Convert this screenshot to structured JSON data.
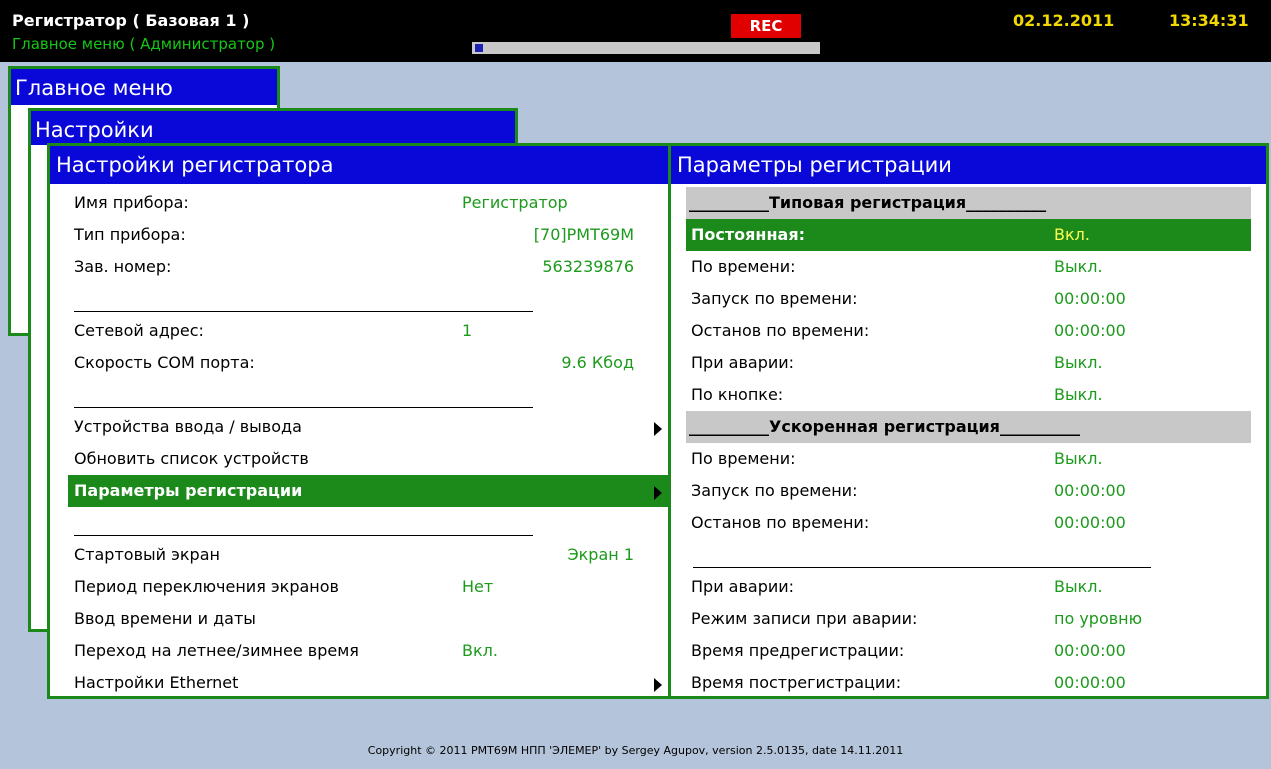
{
  "header": {
    "title": "Регистратор ( Базовая 1 )",
    "subtitle": "Главное меню ( Администратор )",
    "rec_label": "REC",
    "progress": 0.03,
    "date": "02.12.2011",
    "time": "13:34:31"
  },
  "windows": {
    "main_menu_title": "Главное меню",
    "settings_title": "Настройки"
  },
  "left_panel": {
    "title": "Настройки регистратора",
    "rows": [
      {
        "label": "Имя прибора:",
        "value": "Регистратор",
        "align": "left"
      },
      {
        "label": "Тип прибора:",
        "value": "[70]РМТ69М",
        "align": "right"
      },
      {
        "label": "Зав. номер:",
        "value": "563239876",
        "align": "right"
      },
      {
        "separator": true
      },
      {
        "label": "Сетевой адрес:",
        "value": "1",
        "align": "left"
      },
      {
        "label": "Скорость COM порта:",
        "value": "9.6 Кбод",
        "align": "right"
      },
      {
        "separator": true
      },
      {
        "label": "Устройства ввода / вывода",
        "arrow": true
      },
      {
        "label": "Обновить список устройств"
      },
      {
        "label": "Параметры регистрации",
        "arrow": true,
        "selected": true
      },
      {
        "separator": true
      },
      {
        "label": "Стартовый экран",
        "value": "Экран 1",
        "align": "right"
      },
      {
        "label": "Период переключения экранов",
        "value": "Нет",
        "align": "left"
      },
      {
        "label": "Ввод времени и даты"
      },
      {
        "label": "Переход на летнее/зимнее время",
        "value": "Вкл.",
        "align": "left"
      },
      {
        "label": "Настройки Ethernet",
        "arrow": true
      }
    ]
  },
  "right_panel": {
    "title": "Параметры регистрации",
    "rows": [
      {
        "group": "__________Типовая регистрация__________"
      },
      {
        "label": "Постоянная:",
        "value": "Вкл.",
        "selected": true
      },
      {
        "label": "По времени:",
        "value": "Выкл."
      },
      {
        "label": "Запуск по времени:",
        "value": "00:00:00"
      },
      {
        "label": "Останов по времени:",
        "value": "00:00:00"
      },
      {
        "label": "При аварии:",
        "value": "Выкл."
      },
      {
        "label": "По кнопке:",
        "value": "Выкл."
      },
      {
        "group": "__________Ускоренная регистрация__________"
      },
      {
        "label": "По времени:",
        "value": "Выкл."
      },
      {
        "label": "Запуск по времени:",
        "value": "00:00:00"
      },
      {
        "label": "Останов по времени:",
        "value": "00:00:00"
      },
      {
        "separator": true
      },
      {
        "label": "При аварии:",
        "value": "Выкл."
      },
      {
        "label": "Режим записи при аварии:",
        "value": "по уровню"
      },
      {
        "label": "Время предрегистрации:",
        "value": "00:00:00"
      },
      {
        "label": "Время пострегистрации:",
        "value": "00:00:00"
      }
    ]
  },
  "footer": {
    "copyright": "Copyright © 2011 РМТ69М НПП 'ЭЛЕМЕР' by Sergey Agupov, version 2.5.0135, date 14.11.2011"
  },
  "colors": {
    "title_bar": "#0a08d8",
    "frame": "#1b8a1b",
    "value_text": "#1c9a1c",
    "selected_value": "#ffff50",
    "rec": "#e00000",
    "datetime": "#f0d800"
  }
}
